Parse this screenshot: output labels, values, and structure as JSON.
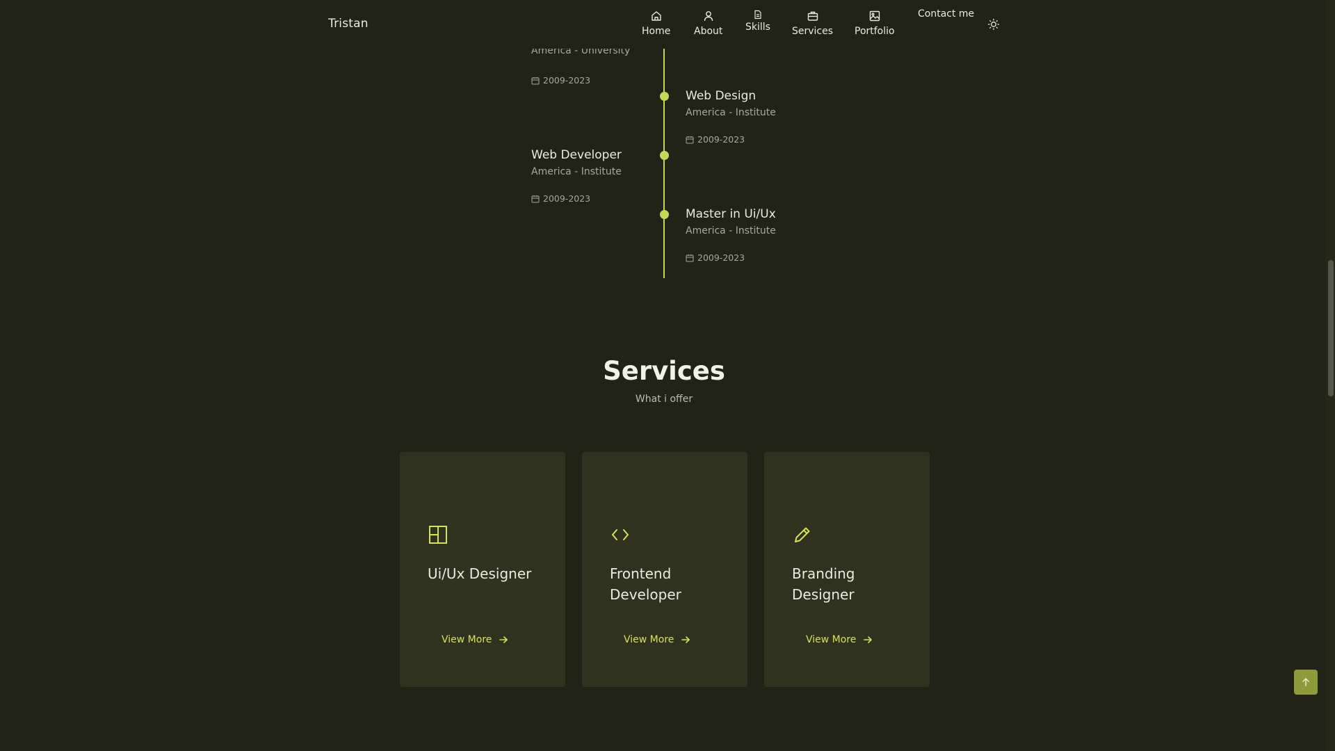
{
  "header": {
    "logo": "Tristan",
    "nav": [
      {
        "label": "Home",
        "icon": "home-icon"
      },
      {
        "label": "About",
        "icon": "user-icon"
      },
      {
        "label": "Skills",
        "icon": "file-icon"
      },
      {
        "label": "Services",
        "icon": "briefcase-icon"
      },
      {
        "label": "Portfolio",
        "icon": "image-icon"
      }
    ],
    "contact": "Contact me",
    "theme_toggle_icon": "sun-icon"
  },
  "timeline": {
    "entries": [
      {
        "title": "",
        "subtitle": "America - University",
        "date": "2009-2023"
      },
      {
        "title": "Web Design",
        "subtitle": "America - Institute",
        "date": "2009-2023"
      },
      {
        "title": "Web Developer",
        "subtitle": "America - Institute",
        "date": "2009-2023"
      },
      {
        "title": "Master in Ui/Ux",
        "subtitle": "America - Institute",
        "date": "2009-2023"
      }
    ]
  },
  "services": {
    "title": "Services",
    "subtitle": "What i offer",
    "cards": [
      {
        "title": "Ui/Ux Designer",
        "icon": "layout-icon",
        "link": "View More"
      },
      {
        "title": "Frontend Developer",
        "icon": "code-icon",
        "link": "View More"
      },
      {
        "title": "Branding Designer",
        "icon": "pencil-icon",
        "link": "View More"
      }
    ]
  },
  "scroll_top_icon": "arrow-up-icon",
  "colors": {
    "background": "#222317",
    "accent": "#c6d957",
    "card": "#303220",
    "link": "#d7e25a"
  }
}
